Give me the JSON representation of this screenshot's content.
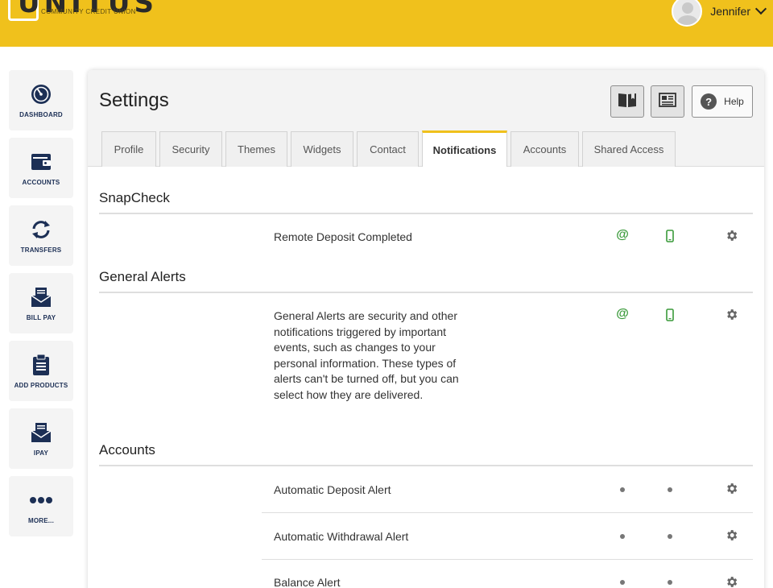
{
  "header": {
    "brand": "UNITUS",
    "brand_sub": "COMMUNITY CREDIT UNION",
    "user_name": "Jennifer",
    "accent_color": "#f0c11c"
  },
  "sidebar": {
    "items": [
      {
        "label": "DASHBOARD",
        "icon": "dashboard-icon"
      },
      {
        "label": "ACCOUNTS",
        "icon": "wallet-icon"
      },
      {
        "label": "TRANSFERS",
        "icon": "transfer-icon"
      },
      {
        "label": "BILL PAY",
        "icon": "envelope-icon"
      },
      {
        "label": "ADD PRODUCTS",
        "icon": "clipboard-icon"
      },
      {
        "label": "IPAY",
        "icon": "envelope-icon"
      },
      {
        "label": "MORE...",
        "icon": "more-icon"
      }
    ]
  },
  "main": {
    "title": "Settings",
    "help_label": "Help",
    "tabs": [
      {
        "label": "Profile"
      },
      {
        "label": "Security"
      },
      {
        "label": "Themes"
      },
      {
        "label": "Widgets"
      },
      {
        "label": "Contact"
      },
      {
        "label": "Notifications",
        "active": true
      },
      {
        "label": "Accounts"
      },
      {
        "label": "Shared Access"
      }
    ],
    "sections": [
      {
        "title": "SnapCheck",
        "rows": [
          {
            "label": "Remote Deposit Completed",
            "email_icon": "@",
            "sms": true
          }
        ]
      },
      {
        "title": "General Alerts",
        "rows": [
          {
            "label": "General Alerts are security and other notifications triggered by important events, such as changes to your personal information. These types of alerts can't be turned off, but you can select how they are delivered.",
            "email_icon": "@",
            "sms": true
          }
        ]
      },
      {
        "title": "Accounts",
        "rows": [
          {
            "label": "Automatic Deposit Alert",
            "email": "off",
            "sms": "off"
          },
          {
            "label": "Automatic Withdrawal Alert",
            "email": "off",
            "sms": "off"
          },
          {
            "label": "Balance Alert",
            "email": "off",
            "sms": "off"
          }
        ]
      }
    ]
  }
}
